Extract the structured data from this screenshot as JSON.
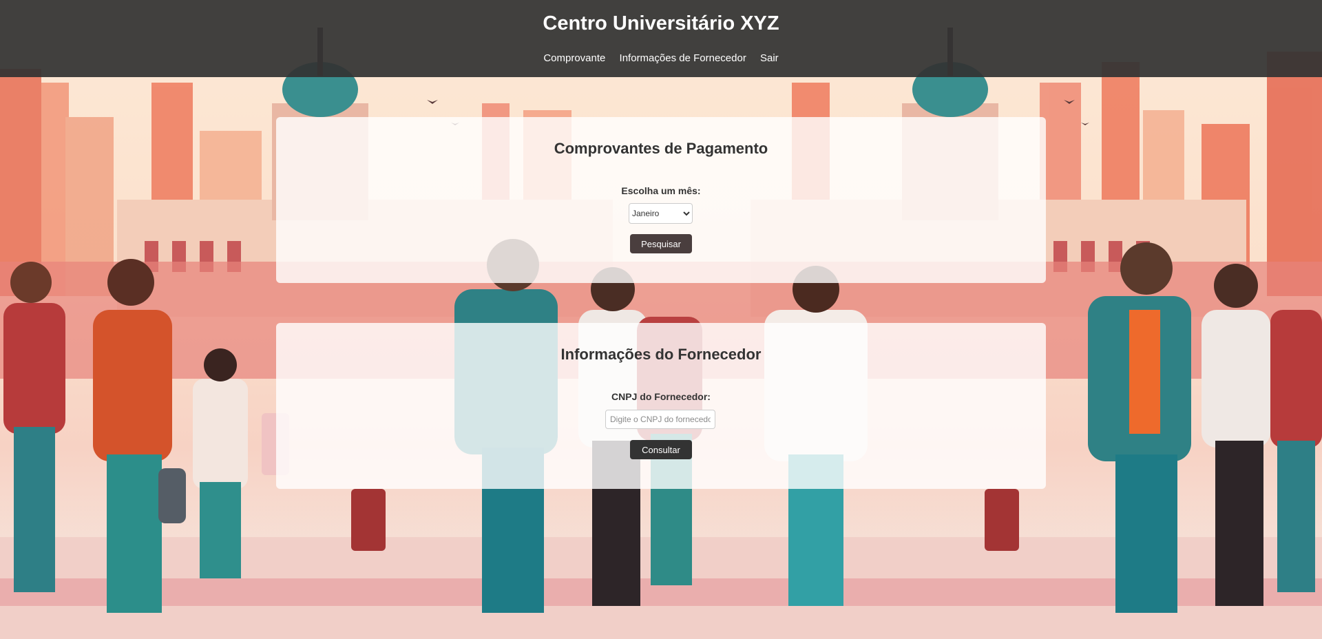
{
  "header": {
    "title": "Centro Universitário XYZ",
    "nav": [
      "Comprovante",
      "Informações de Fornecedor",
      "Sair"
    ]
  },
  "payments": {
    "title": "Comprovantes de Pagamento",
    "month_label": "Escolha um mês:",
    "month_selected": "Janeiro",
    "search_button": "Pesquisar"
  },
  "supplier": {
    "title": "Informações do Fornecedor",
    "cnpj_label": "CNPJ do Fornecedor:",
    "cnpj_placeholder": "Digite o CNPJ do fornecedor",
    "cnpj_value": "",
    "consult_button": "Consultar"
  },
  "colors": {
    "header_bg": "#333333",
    "button_bg": "#333333",
    "card_bg": "#ffffff"
  }
}
